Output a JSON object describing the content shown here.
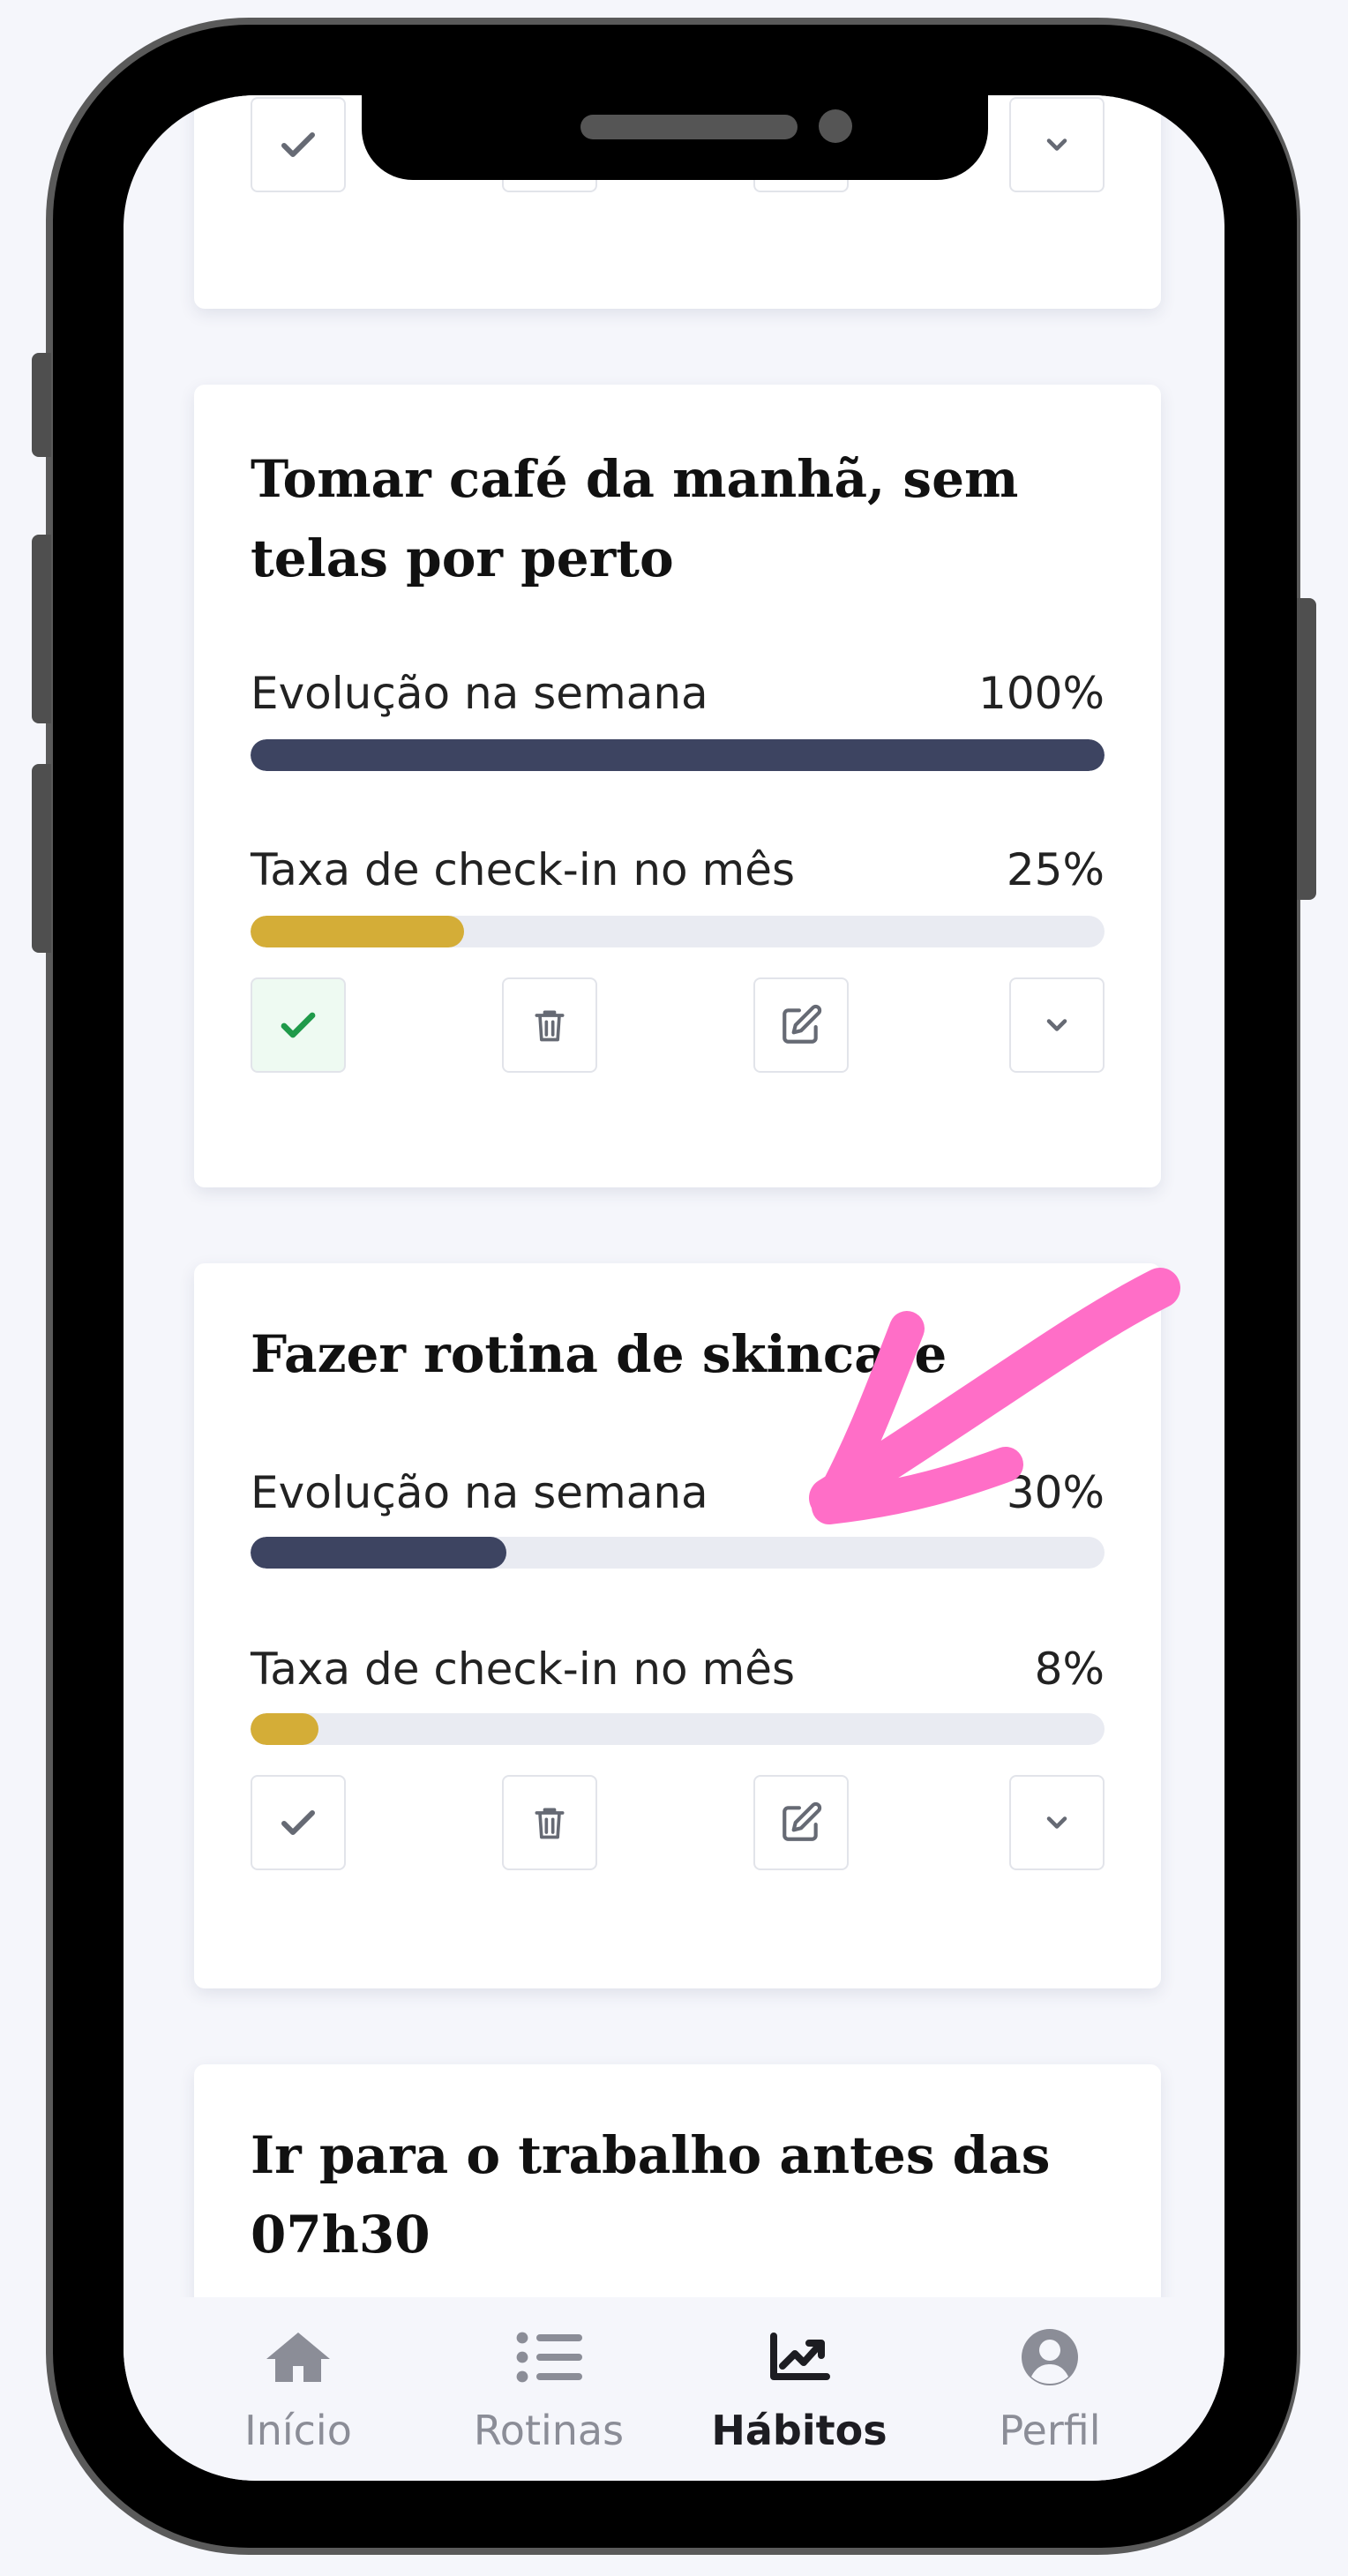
{
  "colors": {
    "accent_dark": "#3d4461",
    "accent_gold": "#d4ad37",
    "check_green": "#1f9a4a",
    "annotation_pink": "#ff6ec7"
  },
  "cards": [
    {
      "title": "Tomar café da manhã, sem telas por perto",
      "week_label": "Evolução na semana",
      "week_value": "100%",
      "week_progress": 100,
      "month_label": "Taxa de check-in no mês",
      "month_value": "25%",
      "month_progress": 25,
      "checked": true
    },
    {
      "title": "Fazer rotina de skincare",
      "week_label": "Evolução na semana",
      "week_value": "30%",
      "week_progress": 30,
      "month_label": "Taxa de check-in no mês",
      "month_value": "8%",
      "month_progress": 8,
      "checked": false
    },
    {
      "title": "Ir para o trabalho antes das 07h30"
    }
  ],
  "icons": {
    "check": "check-icon",
    "delete": "trash-icon",
    "edit": "edit-icon",
    "expand": "chevron-down-icon"
  },
  "nav": {
    "items": [
      {
        "label": "Início",
        "icon": "home-icon",
        "active": false
      },
      {
        "label": "Rotinas",
        "icon": "list-icon",
        "active": false
      },
      {
        "label": "Hábitos",
        "icon": "chart-line-icon",
        "active": true
      },
      {
        "label": "Perfil",
        "icon": "user-circle-icon",
        "active": false
      }
    ]
  }
}
